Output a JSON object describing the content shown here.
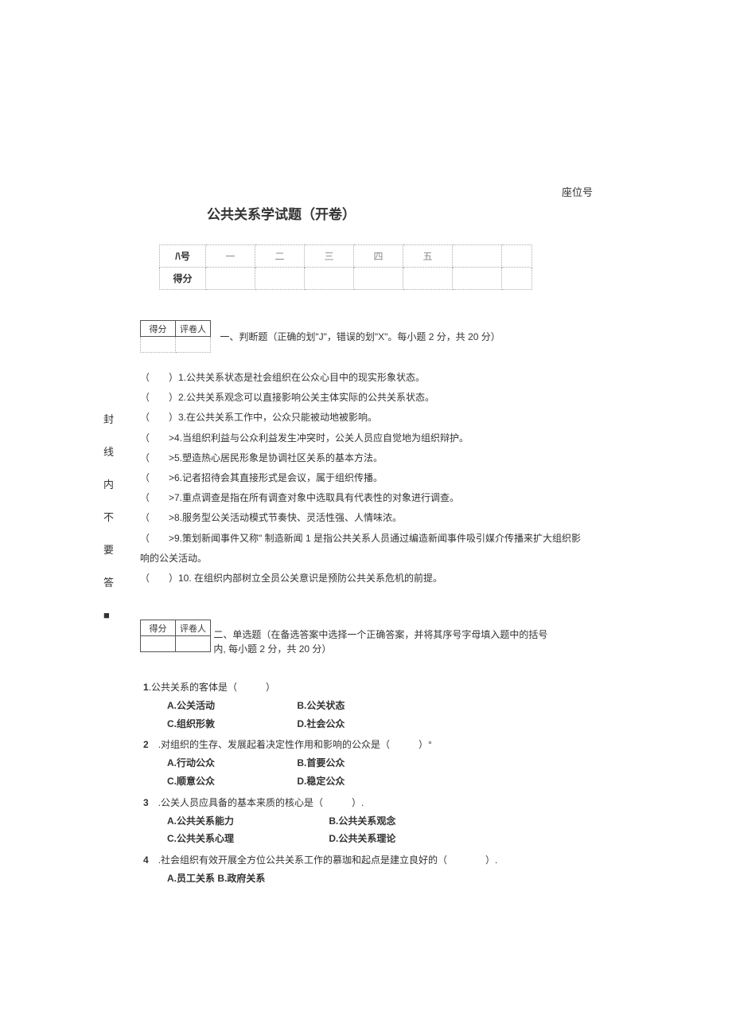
{
  "seat_label": "座位号",
  "title": "公共关系学试题（开卷）",
  "score_table": {
    "row_label_1": "/\\号",
    "row_label_2": "得分",
    "cols": [
      "一",
      "二",
      "三",
      "四",
      "五"
    ]
  },
  "grade_box": {
    "score": "得分",
    "grader": "评卷人"
  },
  "section1": {
    "heading": "一、判断题（正确的划\"J\"，错误的划\"X\"。每小题 2 分，共 20 分）"
  },
  "tf_questions": [
    "（　　）1.公共关系状态是社会组织在公众心目中的现实形象状态。",
    "（　　）2.公共关系观念可以直接影响公关主体实际的公共关系状态。",
    "（　　）3.在公共关系工作中，公众只能被动地被影响。",
    "（　　>4.当组织利益与公众利益发生冲突时，公关人员应自觉地为组织辩护。",
    "（　　>5.塑造热心居民形象是协调社区关系的基本方法。",
    "（　　>6.记者招待会其直接形式是会议，属于组织传播。",
    "（　　>7.重点调查是指在所有调查对象中选取具有代表性的对象进行调查。",
    "（　　>8.服务型公关活动模式节奏快、灵活性强、人情味浓。",
    "（　　>9.策划新闻事件又称\" 制造新闻 1 是指公共关系人员通过编造新闻事件吸引媒介传播来扩大组织影响的公关活动。",
    "（　　）10. 在组织内部树立全员公关意识是预防公共关系危机的前提。"
  ],
  "side_labels": [
    "封",
    "线",
    "内",
    "不",
    "要",
    "答",
    "■"
  ],
  "section2": {
    "heading": "二、单选题（在备选答案中选择一个正确答案，并将其序号字母填入题中的括号内, 每小题 2 分，共 20 分）"
  },
  "mc_questions": [
    {
      "num": "1",
      "stem": ".公共关系的客体是（　　　）",
      "opts": [
        "A.公关活动",
        "B.公关状态",
        "C.组织形敦",
        "D.社会公众"
      ]
    },
    {
      "num": "2",
      "stem": ".对组织的生存、发展起着决定性作用和影响的公众是（　　　）°",
      "opts": [
        "A.行动公众",
        "B.首要公众",
        "C.顺意公众",
        "D.稳定公众"
      ]
    },
    {
      "num": "3",
      "stem": ".公关人员应具备的基本来质的核心是（　　　）.",
      "opts": [
        "A.公共关系能力",
        "B.公共关系观念",
        "C.公共关系心理",
        "D.公共关系理论"
      ]
    },
    {
      "num": "4",
      "stem": ".社会组织有效开展全方位公共关系工作的慕珈和起点是建立良好的（　　　　）.",
      "opts_line": "A.员工关系 B.政府关系"
    }
  ]
}
